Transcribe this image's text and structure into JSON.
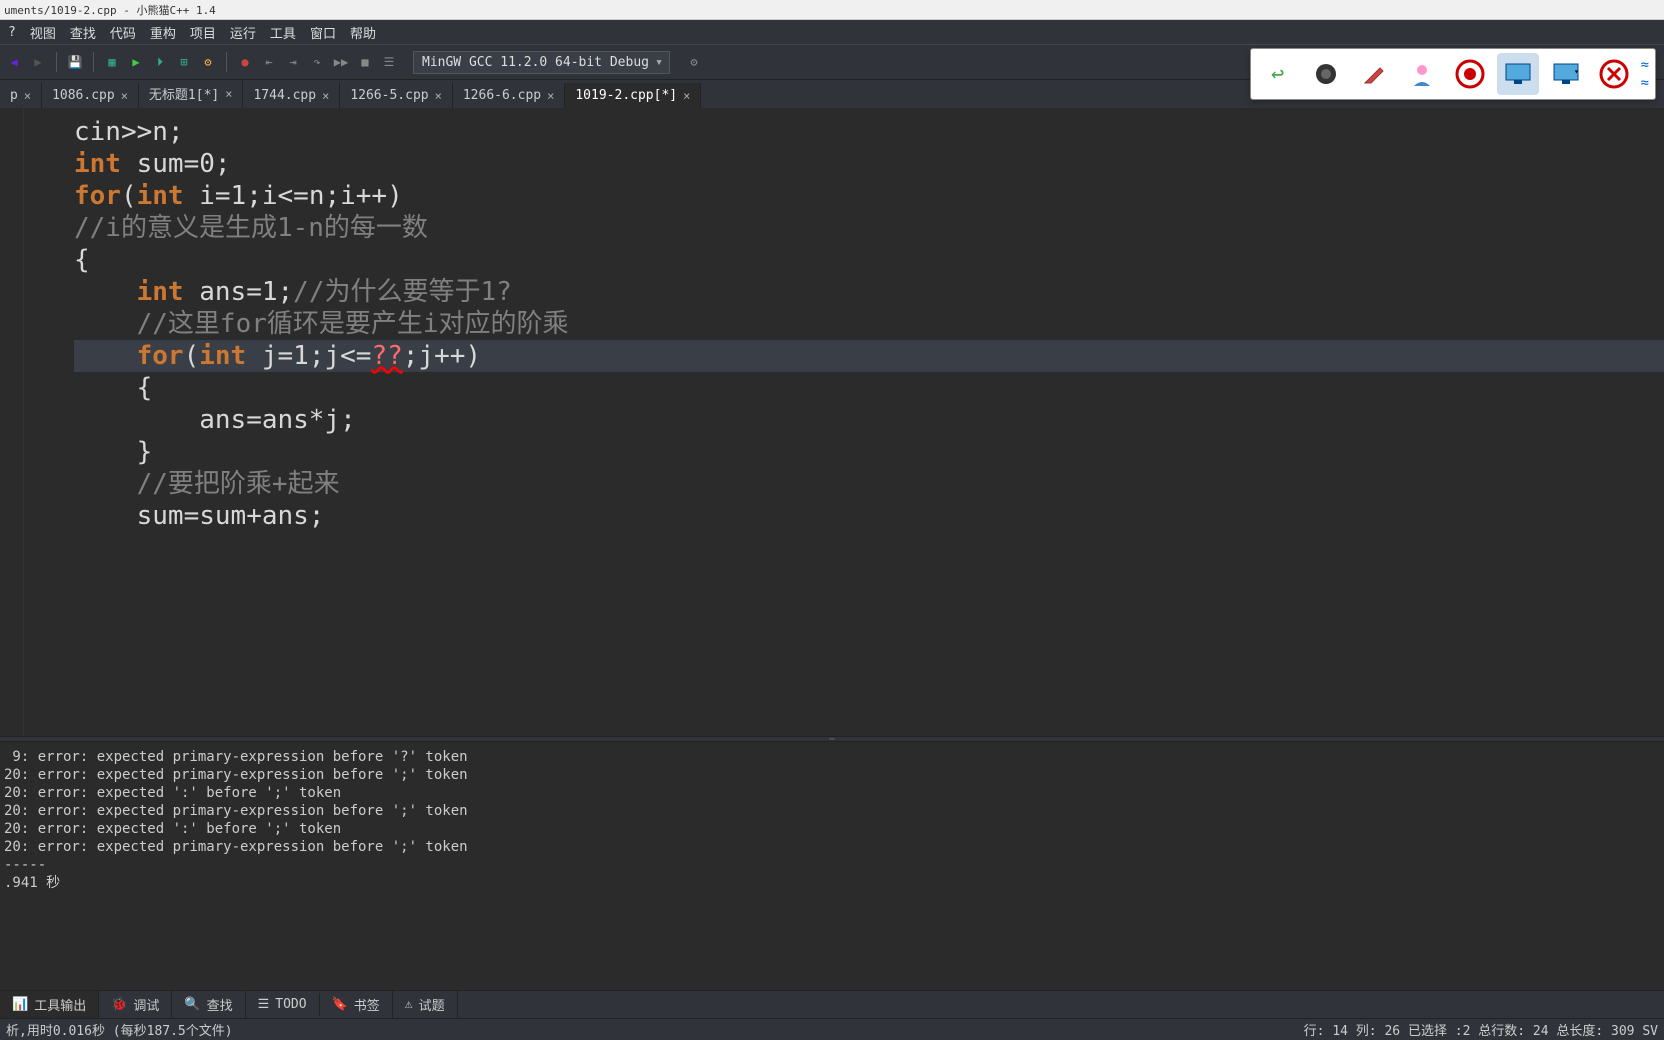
{
  "title": "uments/1019-2.cpp   - 小熊猫C++ 1.4",
  "menu": [
    "?",
    "视图",
    "查找",
    "代码",
    "重构",
    "项目",
    "运行",
    "工具",
    "窗口",
    "帮助"
  ],
  "compiler": "MinGW GCC 11.2.0 64-bit Debug",
  "tabs": [
    {
      "label": "p",
      "close": true
    },
    {
      "label": "1086.cpp",
      "close": true
    },
    {
      "label": "无标题1[*]",
      "close": true
    },
    {
      "label": "1744.cpp",
      "close": true
    },
    {
      "label": "1266-5.cpp",
      "close": true
    },
    {
      "label": "1266-6.cpp",
      "close": true
    },
    {
      "label": "1019-2.cpp[*]",
      "close": true,
      "active": true
    }
  ],
  "code": {
    "l1_a": "cin>>n;",
    "l2_kw": "int",
    "l2_rest": " sum=0;",
    "l3_kw": "for",
    "l3_a": "(",
    "l3_kw2": "int",
    "l3_b": " i=1;i<=n;i++)",
    "l4": "//i的意义是生成1-n的每一数",
    "l5": "{",
    "l6_kw": "int",
    "l6_a": " ans=1;",
    "l6_c": "//为什么要等于1?",
    "l7": "//这里for循环是要产生i对应的阶乘",
    "l8_kw": "for",
    "l8_a": "(",
    "l8_kw2": "int",
    "l8_b": " j=1;j<=",
    "l8_err": "??",
    "l8_c": ";j++)",
    "l9": "{",
    "l10": "ans=ans*j;",
    "l11": "}",
    "l12": "//要把阶乘+起来",
    "l13": "sum=sum+ans;"
  },
  "output": [
    " 9: error: expected primary-expression before '?' token",
    "20: error: expected primary-expression before ';' token",
    "20: error: expected ':' before ';' token",
    "20: error: expected primary-expression before ';' token",
    "20: error: expected ':' before ';' token",
    "20: error: expected primary-expression before ';' token",
    "",
    "-----",
    "",
    ".941 秒"
  ],
  "bottom_tabs": [
    {
      "icon": "📊",
      "label": "工具输出"
    },
    {
      "icon": "🐞",
      "label": "调试"
    },
    {
      "icon": "🔍",
      "label": "查找"
    },
    {
      "icon": "☰",
      "label": "TODO"
    },
    {
      "icon": "🔖",
      "label": "书签"
    },
    {
      "icon": "⚠",
      "label": "试题"
    }
  ],
  "status_left": "析,用时0.016秒 (每秒187.5个文件)",
  "status_right": "行: 14 列: 26 已选择 :2 总行数: 24 总长度: 309     SV",
  "floating": {
    "undo": "↩",
    "camera": "📷",
    "pencil": "✏",
    "user": "👤",
    "record": "⬤",
    "screen1": "🖼",
    "screen2": "🖼",
    "close": "✖",
    "expand": "⏫"
  }
}
